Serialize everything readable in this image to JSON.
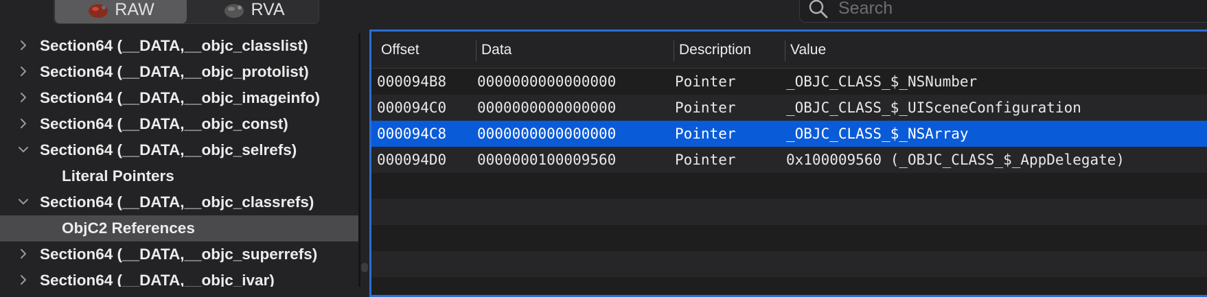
{
  "toolbar": {
    "raw_label": "RAW",
    "rva_label": "RVA",
    "search_placeholder": "Search"
  },
  "tree": [
    {
      "label": "Section64 (__DATA,__objc_classlist)",
      "expanded": false,
      "indent": 0,
      "selected": false
    },
    {
      "label": "Section64 (__DATA,__objc_protolist)",
      "expanded": false,
      "indent": 0,
      "selected": false
    },
    {
      "label": "Section64 (__DATA,__objc_imageinfo)",
      "expanded": false,
      "indent": 0,
      "selected": false
    },
    {
      "label": "Section64 (__DATA,__objc_const)",
      "expanded": false,
      "indent": 0,
      "selected": false
    },
    {
      "label": "Section64 (__DATA,__objc_selrefs)",
      "expanded": true,
      "indent": 0,
      "selected": false
    },
    {
      "label": "Literal Pointers",
      "expanded": null,
      "indent": 1,
      "selected": false
    },
    {
      "label": "Section64 (__DATA,__objc_classrefs)",
      "expanded": true,
      "indent": 0,
      "selected": false
    },
    {
      "label": "ObjC2 References",
      "expanded": null,
      "indent": 1,
      "selected": true
    },
    {
      "label": "Section64 (__DATA,__objc_superrefs)",
      "expanded": false,
      "indent": 0,
      "selected": false
    },
    {
      "label": "Section64 (__DATA,__objc_ivar)",
      "expanded": false,
      "indent": 0,
      "selected": false
    }
  ],
  "table": {
    "columns": [
      "Offset",
      "Data",
      "Description",
      "Value"
    ],
    "rows": [
      {
        "offset": "000094B8",
        "data": "0000000000000000",
        "description": "Pointer",
        "value": "_OBJC_CLASS_$_NSNumber",
        "selected": false
      },
      {
        "offset": "000094C0",
        "data": "0000000000000000",
        "description": "Pointer",
        "value": "_OBJC_CLASS_$_UISceneConfiguration",
        "selected": false
      },
      {
        "offset": "000094C8",
        "data": "0000000000000000",
        "description": "Pointer",
        "value": "_OBJC_CLASS_$_NSArray",
        "selected": true
      },
      {
        "offset": "000094D0",
        "data": "0000000100009560",
        "description": "Pointer",
        "value": "0x100009560 (_OBJC_CLASS_$_AppDelegate)",
        "selected": false
      }
    ]
  },
  "colors": {
    "selection": "#0a5bd8",
    "focus_ring": "#2b6ed6",
    "sidebar_selected": "#4a4a4c"
  }
}
